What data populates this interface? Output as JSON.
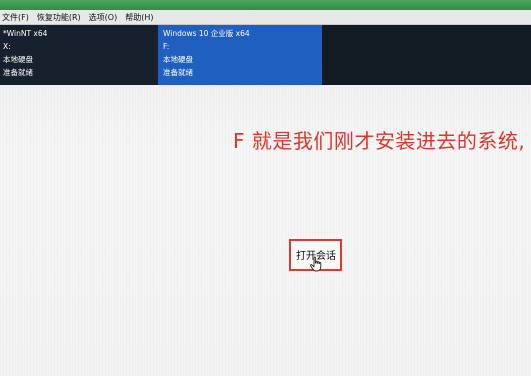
{
  "menubar": {
    "items": [
      "文件(F)",
      "恢复功能(R)",
      "选项(O)",
      "帮助(H)"
    ]
  },
  "systems": [
    {
      "name": "*WinNT x64",
      "drive": "X:",
      "disk": "本地硬盘",
      "status": "准备就绪"
    },
    {
      "name": "Windows 10 企业版 x64",
      "drive": "F:",
      "disk": "本地硬盘",
      "status": "准备就绪"
    }
  ],
  "annotation": "F 就是我们刚才安装进去的系统,",
  "actions": {
    "open_session": "打开会话"
  },
  "icons": {
    "cursor": "hand-pointer-icon"
  },
  "colors": {
    "selected_panel": "#1f5fbf",
    "dark_panel": "#17212e",
    "annotation_text": "#e0342a",
    "highlight_box": "#d93a32",
    "titlebar": "#3a9a4e"
  }
}
